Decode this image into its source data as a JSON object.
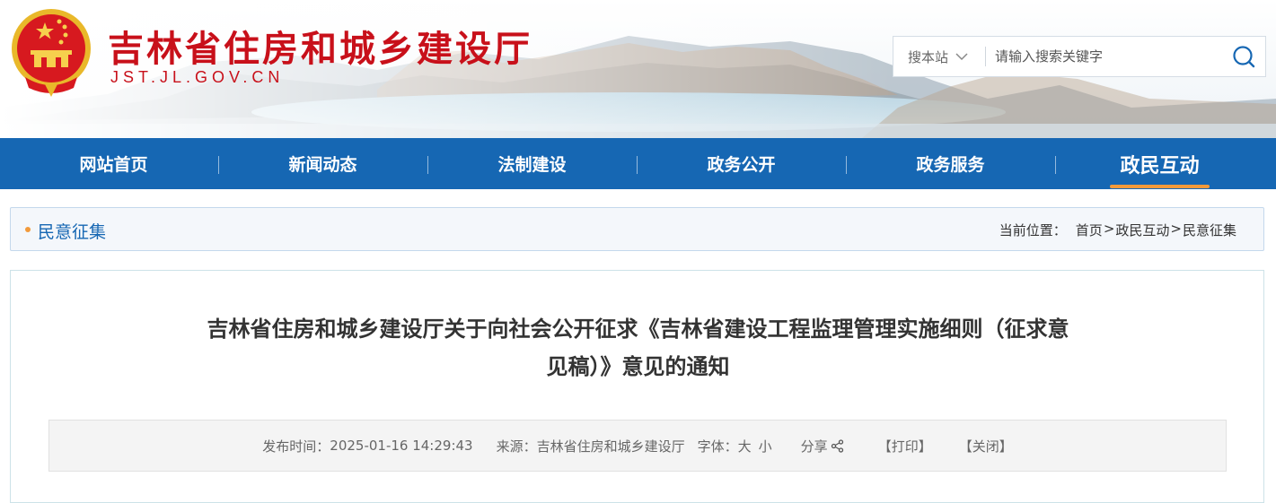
{
  "header": {
    "site_title": "吉林省住房和城乡建设厅",
    "site_domain": "JST.JL.GOV.CN",
    "search": {
      "scope_label": "搜本站",
      "placeholder": "请输入搜索关键字"
    }
  },
  "nav": {
    "items": [
      {
        "label": "网站首页",
        "active": false
      },
      {
        "label": "新闻动态",
        "active": false
      },
      {
        "label": "法制建设",
        "active": false
      },
      {
        "label": "政务公开",
        "active": false
      },
      {
        "label": "政务服务",
        "active": false
      },
      {
        "label": "政民互动",
        "active": true
      }
    ]
  },
  "breadcrumb": {
    "section_title": "民意征集",
    "prefix": "当前位置：",
    "path": [
      "首页",
      "政民互动",
      "民意征集"
    ],
    "separator": ">"
  },
  "article": {
    "title_line1": "吉林省住房和城乡建设厅关于向社会公开征求《吉林省建设工程监理管理实施细则（征求意",
    "title_line2": "见稿）》意见的通知",
    "meta": {
      "publish_label": "发布时间：",
      "publish_time": "2025-01-16 14:29:43",
      "source_label": "来源：",
      "source": "吉林省住房和城乡建设厅",
      "font_label": "字体：",
      "font_large": "大",
      "font_small": "小",
      "share_label": "分享",
      "print_label": "【打印】",
      "close_label": "【关闭】"
    }
  },
  "colors": {
    "nav_bg": "#1667b3",
    "brand_red": "#c8101a",
    "accent_orange": "#f29a3b"
  }
}
